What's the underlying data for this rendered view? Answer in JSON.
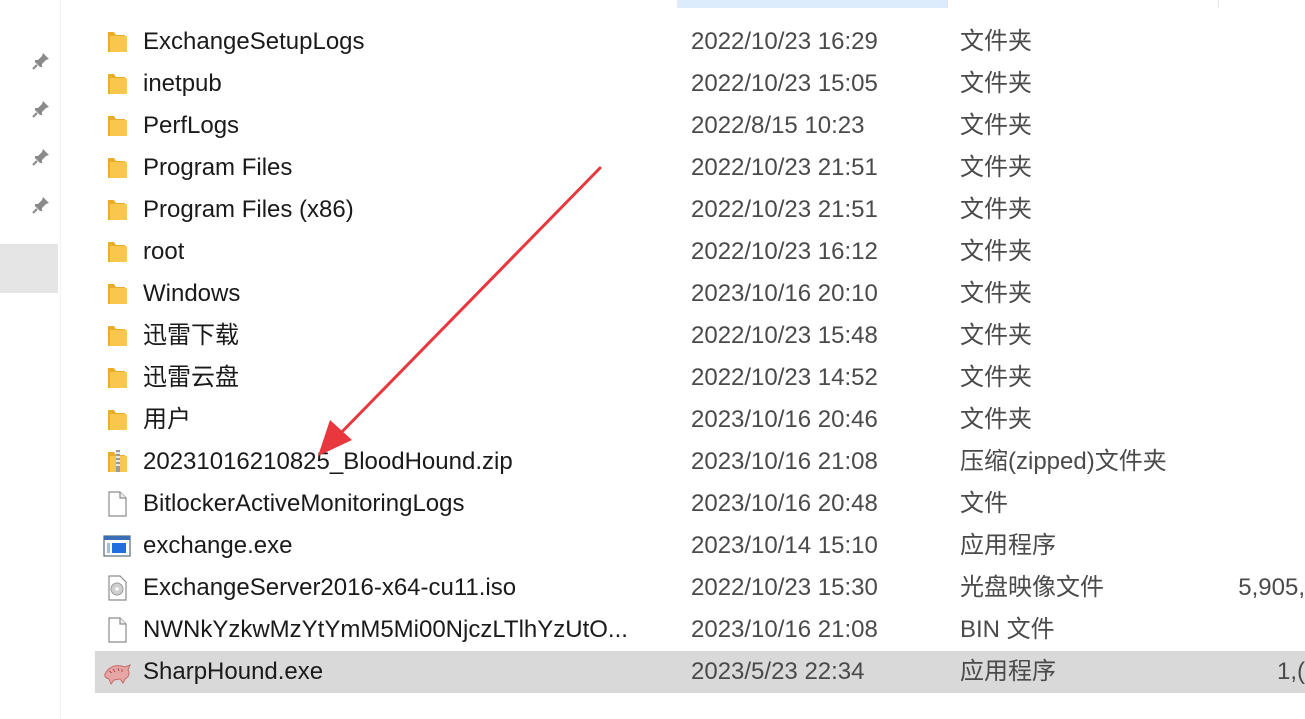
{
  "files": [
    {
      "name": "ExchangeSetupLogs",
      "date": "2022/10/23 16:29",
      "type": "文件夹",
      "size": "",
      "icon": "folder-icon",
      "selected": false
    },
    {
      "name": "inetpub",
      "date": "2022/10/23 15:05",
      "type": "文件夹",
      "size": "",
      "icon": "folder-icon",
      "selected": false
    },
    {
      "name": "PerfLogs",
      "date": "2022/8/15 10:23",
      "type": "文件夹",
      "size": "",
      "icon": "folder-icon",
      "selected": false
    },
    {
      "name": "Program Files",
      "date": "2022/10/23 21:51",
      "type": "文件夹",
      "size": "",
      "icon": "folder-icon",
      "selected": false
    },
    {
      "name": "Program Files (x86)",
      "date": "2022/10/23 21:51",
      "type": "文件夹",
      "size": "",
      "icon": "folder-icon",
      "selected": false
    },
    {
      "name": "root",
      "date": "2022/10/23 16:12",
      "type": "文件夹",
      "size": "",
      "icon": "folder-icon",
      "selected": false
    },
    {
      "name": "Windows",
      "date": "2023/10/16 20:10",
      "type": "文件夹",
      "size": "",
      "icon": "folder-icon",
      "selected": false
    },
    {
      "name": "迅雷下载",
      "date": "2022/10/23 15:48",
      "type": "文件夹",
      "size": "",
      "icon": "folder-icon",
      "selected": false
    },
    {
      "name": "迅雷云盘",
      "date": "2022/10/23 14:52",
      "type": "文件夹",
      "size": "",
      "icon": "folder-icon",
      "selected": false
    },
    {
      "name": "用户",
      "date": "2023/10/16 20:46",
      "type": "文件夹",
      "size": "",
      "icon": "folder-icon",
      "selected": false
    },
    {
      "name": "20231016210825_BloodHound.zip",
      "date": "2023/10/16 21:08",
      "type": "压缩(zipped)文件夹",
      "size": "",
      "icon": "zip-folder-icon",
      "selected": false
    },
    {
      "name": "BitlockerActiveMonitoringLogs",
      "date": "2023/10/16 20:48",
      "type": "文件",
      "size": "",
      "icon": "file-icon",
      "selected": false
    },
    {
      "name": "exchange.exe",
      "date": "2023/10/14 15:10",
      "type": "应用程序",
      "size": "",
      "icon": "exe-window-icon",
      "selected": false
    },
    {
      "name": "ExchangeServer2016-x64-cu11.iso",
      "date": "2022/10/23 15:30",
      "type": "光盘映像文件",
      "size": "5,905,",
      "icon": "disc-image-icon",
      "selected": false
    },
    {
      "name": "NWNkYzkwMzYtYmM5Mi00NjczLTlhYzUtO...",
      "date": "2023/10/16 21:08",
      "type": "BIN 文件",
      "size": "",
      "icon": "file-icon",
      "selected": false
    },
    {
      "name": "SharpHound.exe",
      "date": "2023/5/23 22:34",
      "type": "应用程序",
      "size": "1,(",
      "icon": "sharphound-icon",
      "selected": true
    }
  ],
  "colors": {
    "selection": "#d9d9d9",
    "folder": "#f8c74b",
    "arrow": "#e8383d",
    "header_highlight": "#dcecfc"
  },
  "nav_pins": [
    "pin-icon",
    "pin-icon",
    "pin-icon",
    "pin-icon"
  ]
}
